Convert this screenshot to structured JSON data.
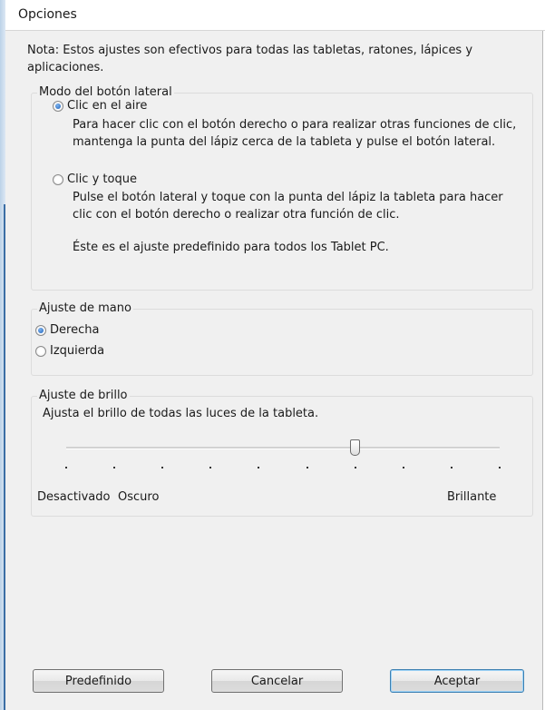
{
  "window": {
    "title": "Opciones"
  },
  "note": "Nota: Estos ajustes son efectivos para todas las tabletas, ratones, lápices y aplicaciones.",
  "side_button_mode": {
    "legend": "Modo del botón lateral",
    "options": [
      {
        "label": "Clic en el aire",
        "checked": true,
        "description": "Para hacer clic con el botón derecho o para realizar otras funciones de clic, mantenga la punta del lápiz cerca de la tableta y pulse el botón lateral."
      },
      {
        "label": "Clic y toque",
        "checked": false,
        "description": "Pulse el botón lateral y toque con la punta del lápiz la tableta para hacer clic con el botón derecho o realizar otra función de clic.",
        "extra": "Éste es el ajuste predefinido para todos los Tablet PC."
      }
    ]
  },
  "handedness": {
    "legend": "Ajuste de mano",
    "options": [
      {
        "label": "Derecha",
        "checked": true
      },
      {
        "label": "Izquierda",
        "checked": false
      }
    ]
  },
  "brightness": {
    "legend": "Ajuste de brillo",
    "description": "Ajusta el brillo de todas las luces de la tableta.",
    "slider": {
      "steps": 10,
      "value_index": 6
    },
    "labels": {
      "off": "Desactivado",
      "dark": "Oscuro",
      "bright": "Brillante"
    }
  },
  "buttons": {
    "default": "Predefinido",
    "cancel": "Cancelar",
    "ok": "Aceptar"
  }
}
